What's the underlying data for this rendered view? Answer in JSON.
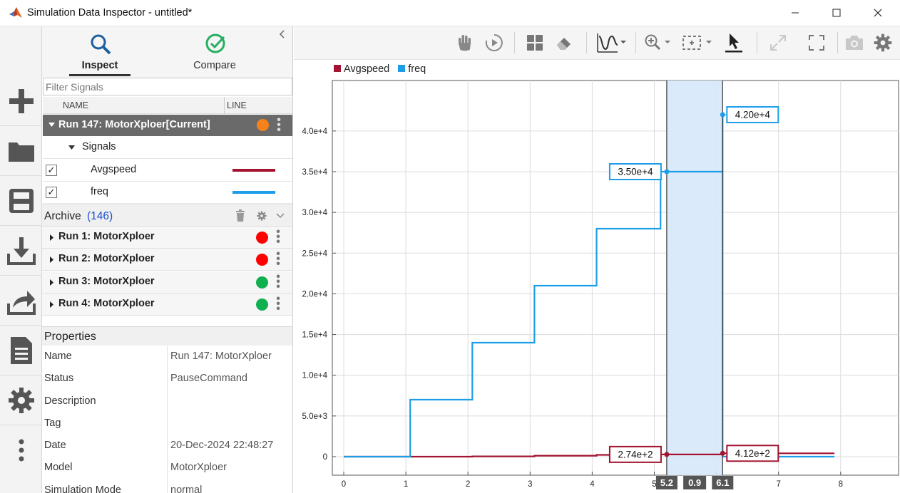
{
  "window": {
    "title": "Simulation Data Inspector - untitled*"
  },
  "left_toolbar": {
    "icons": [
      "new-icon",
      "open-folder-icon",
      "save-icon",
      "import-icon",
      "export-icon",
      "report-icon",
      "settings-icon",
      "more-icon"
    ]
  },
  "tabs": [
    {
      "label": "Inspect",
      "icon": "search-icon",
      "active": true
    },
    {
      "label": "Compare",
      "icon": "check-circle-icon",
      "active": false
    }
  ],
  "filter": {
    "placeholder": "Filter Signals",
    "value": ""
  },
  "columns": {
    "name": "NAME",
    "line": "LINE"
  },
  "current_run": {
    "label": "Run 147: MotorXploer[Current]",
    "color": "#f7821b",
    "group_label": "Signals",
    "signals": [
      {
        "name": "Avgspeed",
        "checked": true,
        "check_mark": "✓",
        "color": "#a2142f"
      },
      {
        "name": "freq",
        "checked": true,
        "check_mark": "✓",
        "color": "#1e9ee8"
      }
    ]
  },
  "archive": {
    "label": "Archive",
    "count": "(146)",
    "runs": [
      {
        "label": "Run 1: MotorXploer",
        "color": "#ff0000"
      },
      {
        "label": "Run 2: MotorXploer",
        "color": "#ff0000"
      },
      {
        "label": "Run 3: MotorXploer",
        "color": "#10b050"
      },
      {
        "label": "Run 4: MotorXploer",
        "color": "#10b050"
      }
    ]
  },
  "properties": {
    "title": "Properties",
    "rows": [
      {
        "key": "Name",
        "value": "Run 147: MotorXploer"
      },
      {
        "key": "Status",
        "value": "PauseCommand"
      },
      {
        "key": "Description",
        "value": ""
      },
      {
        "key": "Tag",
        "value": ""
      },
      {
        "key": "Date",
        "value": "20-Dec-2024 22:48:27"
      },
      {
        "key": "Model",
        "value": "MotorXploer"
      },
      {
        "key": "Simulation Mode",
        "value": "normal"
      }
    ]
  },
  "plot_toolbar": {
    "icons": [
      "pan-hand-icon",
      "play-icon",
      "layout-icon",
      "eraser-icon",
      "signal-style-icon",
      "zoom-icon",
      "fit-icon",
      "cursor-icon",
      "expand-icon",
      "fullscreen-icon",
      "camera-icon",
      "gear-icon"
    ]
  },
  "chart_data": {
    "type": "line",
    "xlim": [
      0,
      8
    ],
    "ylim": [
      0,
      42000
    ],
    "x_ticks": [
      "0",
      "1",
      "2",
      "3",
      "4",
      "5",
      "6",
      "7",
      "8"
    ],
    "y_ticks": [
      {
        "value": 0,
        "label": "0"
      },
      {
        "value": 5000,
        "label": "5.0e+3"
      },
      {
        "value": 10000,
        "label": "1.0e+4"
      },
      {
        "value": 15000,
        "label": "1.5e+4"
      },
      {
        "value": 20000,
        "label": "2.0e+4"
      },
      {
        "value": 25000,
        "label": "2.5e+4"
      },
      {
        "value": 30000,
        "label": "3.0e+4"
      },
      {
        "value": 35000,
        "label": "3.5e+4"
      },
      {
        "value": 40000,
        "label": "4.0e+4"
      }
    ],
    "grid": true,
    "legend": "top-left",
    "series": [
      {
        "name": "Avgspeed",
        "color": "#a2142f",
        "step": true,
        "x": [
          0,
          1.07,
          2.07,
          3.07,
          4.07,
          5.1,
          6.1,
          7.9
        ],
        "y": [
          0,
          0,
          30,
          120,
          220,
          274,
          412,
          412
        ]
      },
      {
        "name": "freq",
        "color": "#1e9ee8",
        "step": true,
        "x": [
          0,
          1.07,
          2.07,
          3.07,
          4.07,
          5.1,
          6.1,
          7.9
        ],
        "y": [
          0,
          7000,
          14000,
          21000,
          28000,
          35000,
          0,
          0
        ]
      }
    ],
    "cursors": {
      "left": {
        "x": 5.2,
        "label": "5.2"
      },
      "right": {
        "x": 6.1,
        "label": "6.1"
      },
      "delta_label": "0.9"
    },
    "data_labels": [
      {
        "text": "4.20e+4",
        "series": "freq",
        "x": 6.1,
        "y": 42000,
        "side": "right"
      },
      {
        "text": "3.50e+4",
        "series": "freq",
        "x": 5.2,
        "y": 35000,
        "side": "left"
      },
      {
        "text": "2.74e+2",
        "series": "Avgspeed",
        "x": 5.2,
        "y": 274,
        "side": "left"
      },
      {
        "text": "4.12e+2",
        "series": "Avgspeed",
        "x": 6.1,
        "y": 412,
        "side": "right"
      }
    ]
  }
}
